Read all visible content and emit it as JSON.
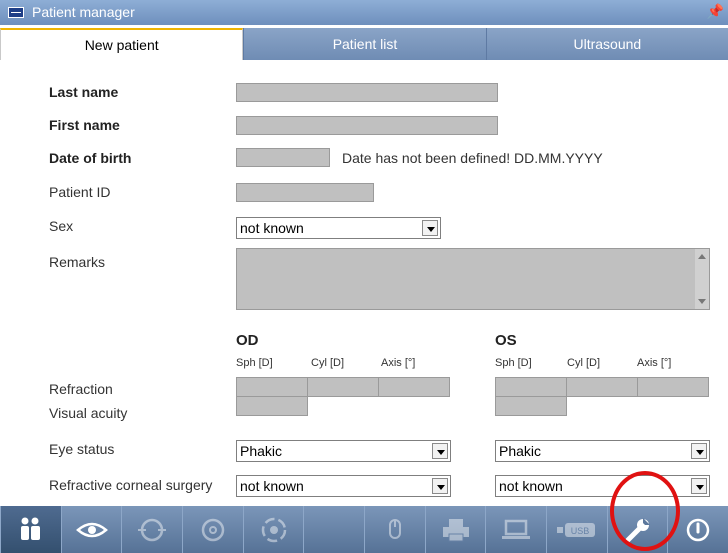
{
  "window": {
    "title": "Patient manager"
  },
  "tabs": [
    {
      "label": "New patient",
      "active": true
    },
    {
      "label": "Patient list",
      "active": false
    },
    {
      "label": "Ultrasound",
      "active": false
    }
  ],
  "form": {
    "last_name_label": "Last name",
    "first_name_label": "First name",
    "dob_label": "Date of birth",
    "dob_message": "Date has not been defined!  DD.MM.YYYY",
    "patient_id_label": "Patient ID",
    "sex_label": "Sex",
    "sex_value": "not known",
    "remarks_label": "Remarks"
  },
  "eyes": {
    "od": {
      "title": "OD",
      "sph": "Sph [D]",
      "cyl": "Cyl [D]",
      "axis": "Axis [°]",
      "eye_status": "Phakic",
      "surgery": "not known"
    },
    "os": {
      "title": "OS",
      "sph": "Sph [D]",
      "cyl": "Cyl [D]",
      "axis": "Axis [°]",
      "eye_status": "Phakic",
      "surgery": "not known"
    },
    "refraction_label": "Refraction",
    "visual_acuity_label": "Visual acuity",
    "eye_status_label": "Eye status",
    "refractive_surgery_label": "Refractive corneal surgery"
  },
  "toolbar": {
    "usb_label": "USB",
    "icons": [
      "patient-icon",
      "eye-icon",
      "eye-scan-left-icon",
      "eye-scan-right-icon",
      "target-scan-icon",
      "blank",
      "mouse-icon",
      "printer-icon",
      "laptop-icon",
      "usb-icon",
      "wrench-icon",
      "power-icon"
    ]
  },
  "colors": {
    "accent": "#f0b400",
    "highlight": "#e01212",
    "field": "#c0c0c0"
  }
}
